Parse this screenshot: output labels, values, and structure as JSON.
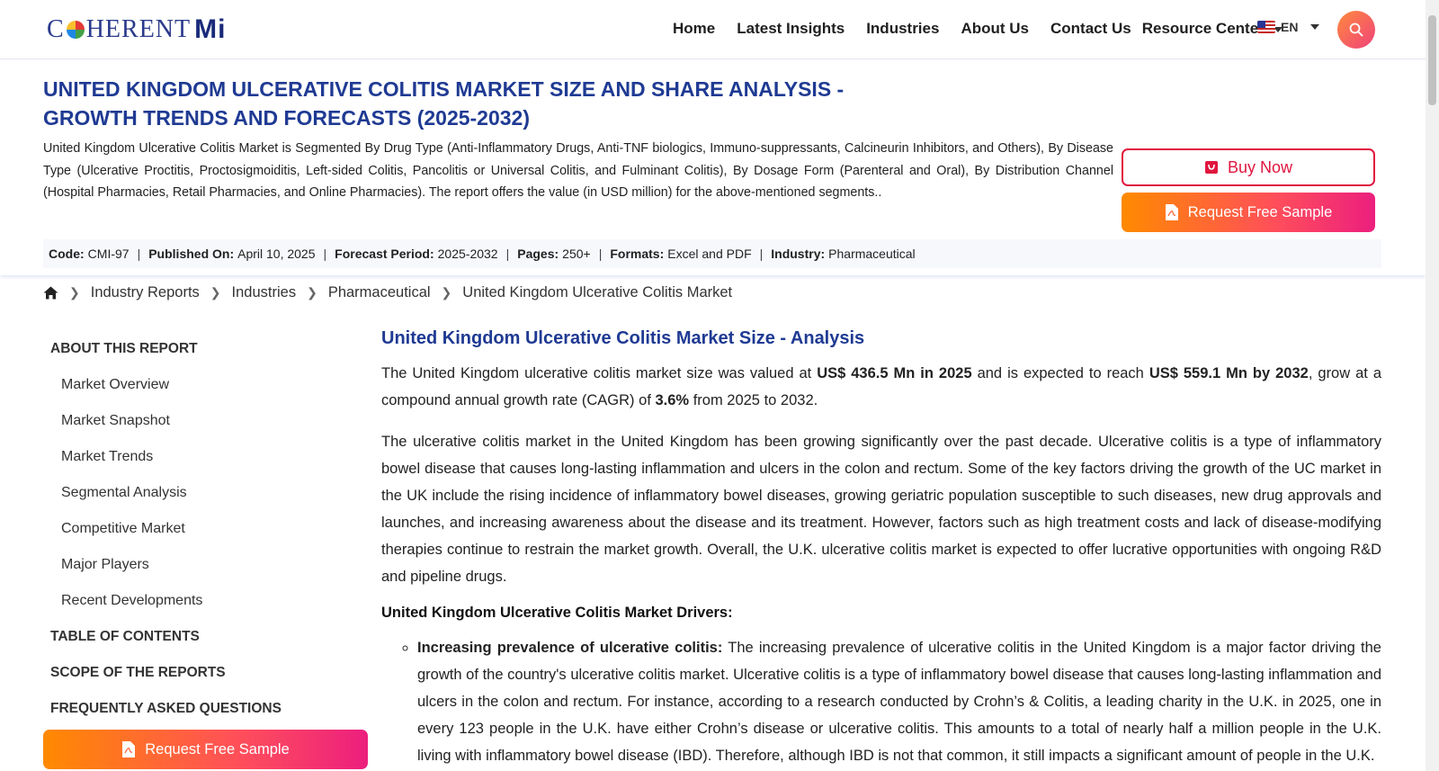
{
  "header": {
    "logo_text_left": "C",
    "logo_text_mid": "HERENT",
    "logo_text_mi": "Mi",
    "nav": [
      "Home",
      "Latest Insights",
      "Industries",
      "About Us",
      "Contact Us",
      "Resource Center"
    ],
    "language": "EN"
  },
  "report": {
    "title": "United Kingdom Ulcerative Colitis Market Size and Share Analysis - Growth Trends and Forecasts (2025-2032)",
    "description": "United Kingdom Ulcerative Colitis Market is Segmented By Drug Type (Anti-Inflammatory Drugs, Anti-TNF biologics, Immuno-suppressants, Calcineurin Inhibitors, and Others), By Disease Type (Ulcerative Proctitis, Proctosigmoiditis, Left-sided Colitis, Pancolitis or Universal Colitis, and Fulminant Colitis), By Dosage Form (Parenteral and Oral), By Distribution Channel (Hospital Pharmacies, Retail Pharmacies, and Online Pharmacies). The report offers the value (in USD million) for the above-mentioned segments..",
    "buy_label": "Buy Now",
    "sample_label": "Request Free Sample",
    "meta": {
      "code_label": "Code:",
      "code": "CMI-97",
      "published_label": "Published On:",
      "published": "April 10, 2025",
      "forecast_label": "Forecast Period:",
      "forecast": "2025-2032",
      "pages_label": "Pages:",
      "pages": "250+",
      "formats_label": "Formats:",
      "formats": "Excel and PDF",
      "industry_label": "Industry:",
      "industry": "Pharmaceutical"
    }
  },
  "breadcrumb": [
    "Industry Reports",
    "Industries",
    "Pharmaceutical",
    "United Kingdom Ulcerative Colitis Market"
  ],
  "sidebar": {
    "about_head": "About This Report",
    "items": [
      "Market Overview",
      "Market Snapshot",
      "Market Trends",
      "Segmental Analysis",
      "Competitive Market",
      "Major Players",
      "Recent Developments"
    ],
    "toc": "Table of Contents",
    "scope": "Scope of the Reports",
    "faq": "Frequently Asked Questions",
    "sample_label": "Request Free Sample"
  },
  "main": {
    "heading": "United Kingdom Ulcerative Colitis Market Size - Analysis",
    "p1_a": "The United Kingdom ulcerative colitis market size was valued at ",
    "p1_b": "US$ 436.5 Mn in 2025",
    "p1_c": " and is expected to reach ",
    "p1_d": "US$ 559.1 Mn by 2032",
    "p1_e": ", grow at a compound annual growth rate (CAGR) of ",
    "p1_f": "3.6%",
    "p1_g": " from 2025 to 2032.",
    "p2": "The ulcerative colitis market in the United Kingdom has been growing significantly over the past decade. Ulcerative colitis is a type of inflammatory bowel disease that causes long-lasting inflammation and ulcers in the colon and rectum. Some of the key factors driving the growth of the UC market in the UK include the rising incidence of inflammatory bowel diseases, growing geriatric population susceptible to such diseases, new drug approvals and launches, and increasing awareness about the disease and its treatment. However, factors such as high treatment costs and lack of disease-modifying therapies continue to restrain the market growth. Overall, the U.K. ulcerative colitis market is expected to offer lucrative opportunities with ongoing R&D and pipeline drugs.",
    "drivers_heading": "United Kingdom Ulcerative Colitis Market Drivers:",
    "driver1_title": "Increasing prevalence of ulcerative colitis:",
    "driver1_text": " The increasing prevalence of ulcerative colitis in the United Kingdom is a major factor driving the growth of the country's ulcerative colitis market. Ulcerative colitis is a type of inflammatory bowel disease that causes long-lasting inflammation and ulcers in the colon and rectum. For instance, according to a research conducted by Crohn’s & Colitis, a leading charity in the U.K. in 2025, one in every 123 people in the U.K. have either Crohn’s disease or ulcerative colitis. This amounts to a total of nearly half a million people in the U.K. living with inflammatory bowel disease (IBD). Therefore, although IBD is not that common, it still impacts a significant amount of people in the U.K."
  }
}
